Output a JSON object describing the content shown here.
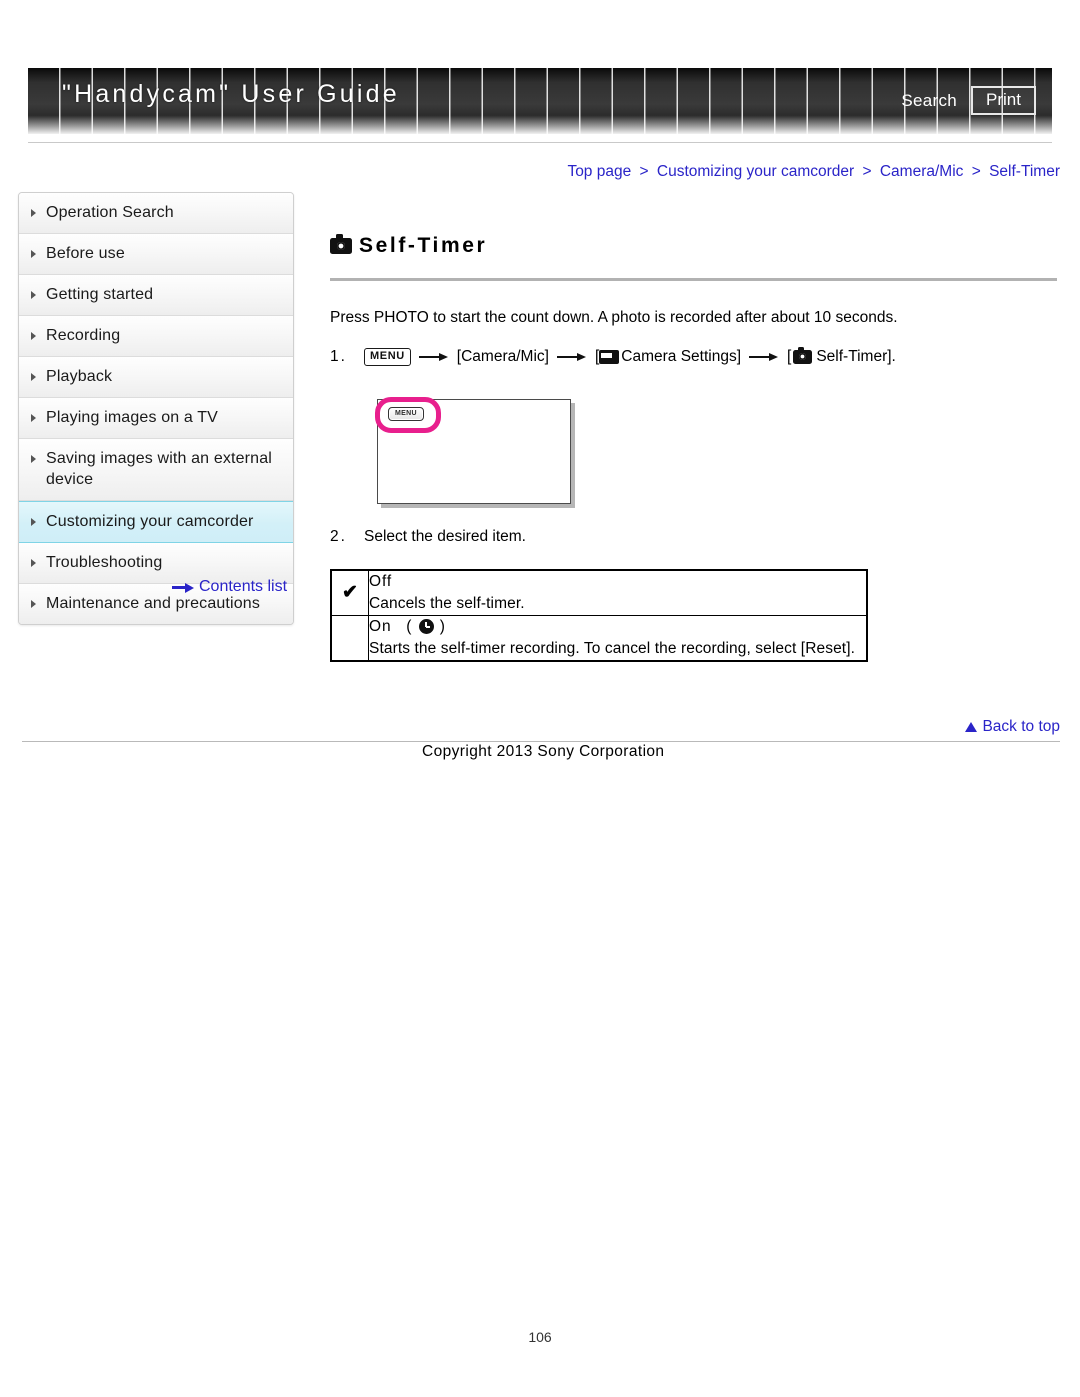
{
  "header": {
    "title": "\"Handycam\" User Guide",
    "search_label": "Search",
    "print_label": "Print"
  },
  "breadcrumb": {
    "items": [
      "Top page",
      "Customizing your camcorder",
      "Camera/Mic",
      "Self-Timer"
    ],
    "separator": ">"
  },
  "sidebar": {
    "items": [
      {
        "label": "Operation Search",
        "active": false
      },
      {
        "label": "Before use",
        "active": false
      },
      {
        "label": "Getting started",
        "active": false
      },
      {
        "label": "Recording",
        "active": false
      },
      {
        "label": "Playback",
        "active": false
      },
      {
        "label": "Playing images on a TV",
        "active": false
      },
      {
        "label": "Saving images with an external device",
        "active": false
      },
      {
        "label": "Customizing your camcorder",
        "active": true
      },
      {
        "label": "Troubleshooting",
        "active": false
      },
      {
        "label": "Maintenance and precautions",
        "active": false
      }
    ],
    "contents_list_label": "Contents list"
  },
  "main": {
    "title": "Self-Timer",
    "title_icon": "camera-icon",
    "intro": "Press PHOTO to start the count down. A photo is recorded after about 10 seconds.",
    "steps": [
      {
        "number": "1.",
        "menu_icon_label": "MENU",
        "part_camera_mic": "[Camera/Mic]",
        "part_camera_settings_open": "[",
        "part_camera_settings": "Camera Settings]",
        "part_self_timer_open": "[",
        "part_self_timer": "Self-Timer]."
      },
      {
        "number": "2.",
        "text": "Select the desired item."
      }
    ],
    "illustration": {
      "menu_button_label": "MENU",
      "highlight_color": "#e81f8d"
    },
    "options_table": [
      {
        "checked": true,
        "check_glyph": "✔",
        "name": "Off",
        "description": "Cancels the self-timer.",
        "has_icon": false
      },
      {
        "checked": false,
        "check_glyph": "",
        "name": "On",
        "icon_open": "(",
        "icon_close": ")",
        "description": "Starts the self-timer recording. To cancel the recording, select [Reset].",
        "has_icon": true
      }
    ]
  },
  "footer": {
    "back_to_top_label": "Back to top",
    "copyright": "Copyright 2013 Sony Corporation",
    "page_number": "106"
  }
}
